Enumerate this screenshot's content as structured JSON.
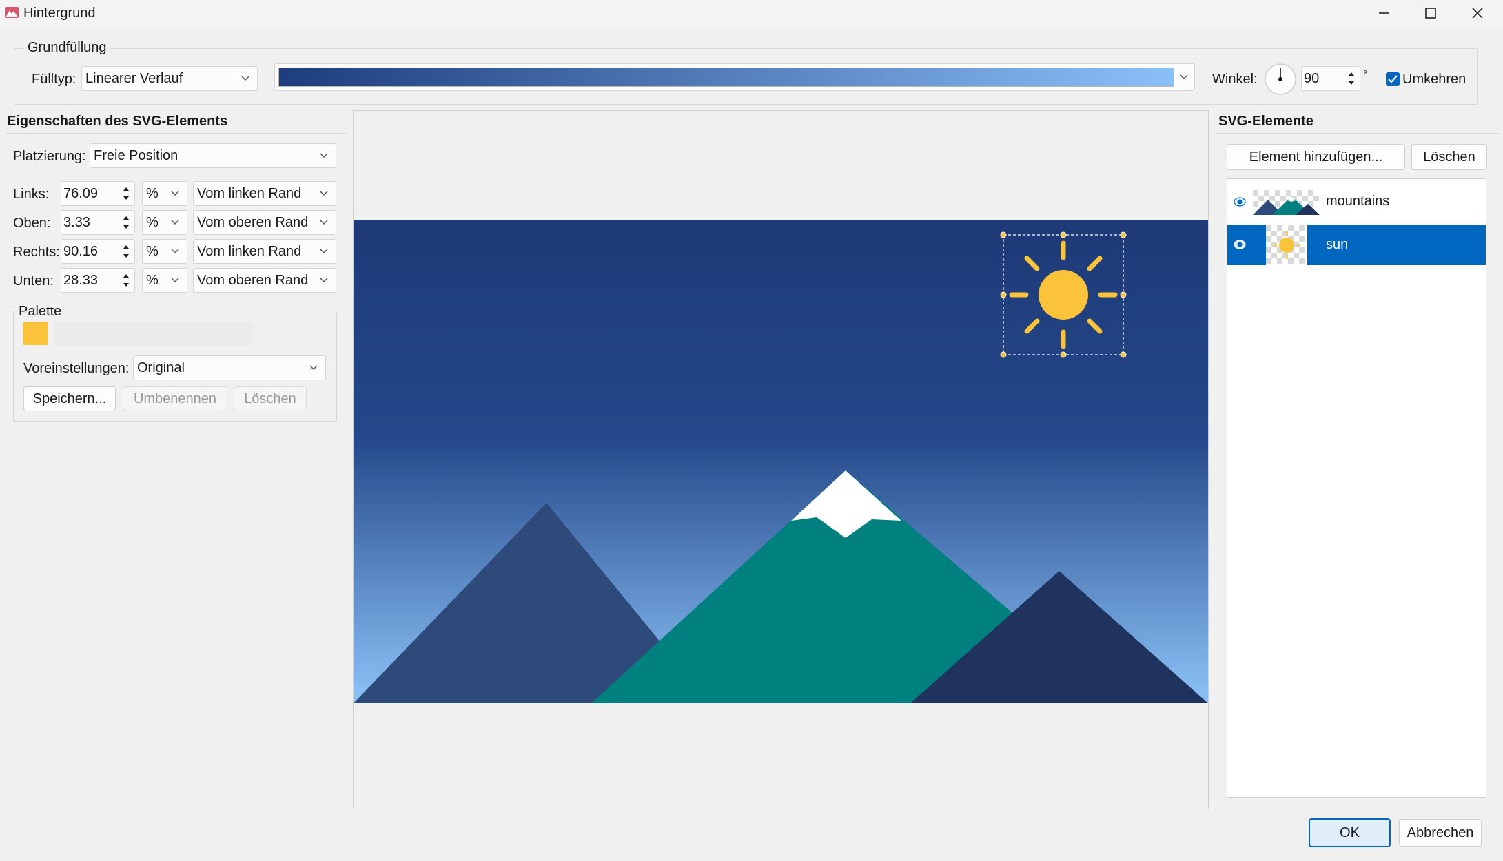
{
  "window": {
    "title": "Hintergrund"
  },
  "fill": {
    "group_label": "Grundfüllung",
    "type_label": "Fülltyp:",
    "type_value": "Linearer Verlauf",
    "gradient_start": "#1d3d7c",
    "gradient_end": "#8ac0f8",
    "angle_label": "Winkel:",
    "angle_value": "90",
    "angle_unit": "°",
    "reverse_label": "Umkehren",
    "reverse_checked": true
  },
  "props": {
    "title": "Eigenschaften des SVG-Elements",
    "placement_label": "Platzierung:",
    "placement_value": "Freie Position",
    "rows": [
      {
        "label": "Links:",
        "value": "76.09",
        "unit": "%",
        "ref": "Vom linken Rand"
      },
      {
        "label": "Oben:",
        "value": "3.33",
        "unit": "%",
        "ref": "Vom oberen Rand"
      },
      {
        "label": "Rechts:",
        "value": "90.16",
        "unit": "%",
        "ref": "Vom linken Rand"
      },
      {
        "label": "Unten:",
        "value": "28.33",
        "unit": "%",
        "ref": "Vom oberen Rand"
      }
    ],
    "palette": {
      "label": "Palette",
      "swatch_color": "#fbc33a",
      "presets_label": "Voreinstellungen:",
      "presets_value": "Original",
      "save_label": "Speichern...",
      "rename_label": "Umbenennen",
      "delete_label": "Löschen"
    }
  },
  "preview": {
    "sky_top": "#1e3a77",
    "sky_bottom": "#8cc3f7",
    "mountain_left": "#2d4a7a",
    "mountain_center": "#00807f",
    "mountain_right": "#1f335e",
    "snow": "#ffffff",
    "sun": "#fbc33a"
  },
  "elements": {
    "title": "SVG-Elemente",
    "add_label": "Element hinzufügen...",
    "delete_label": "Löschen",
    "items": [
      {
        "name": "mountains",
        "visible": true,
        "selected": false
      },
      {
        "name": "sun",
        "visible": true,
        "selected": true
      }
    ]
  },
  "footer": {
    "ok_label": "OK",
    "cancel_label": "Abbrechen"
  }
}
